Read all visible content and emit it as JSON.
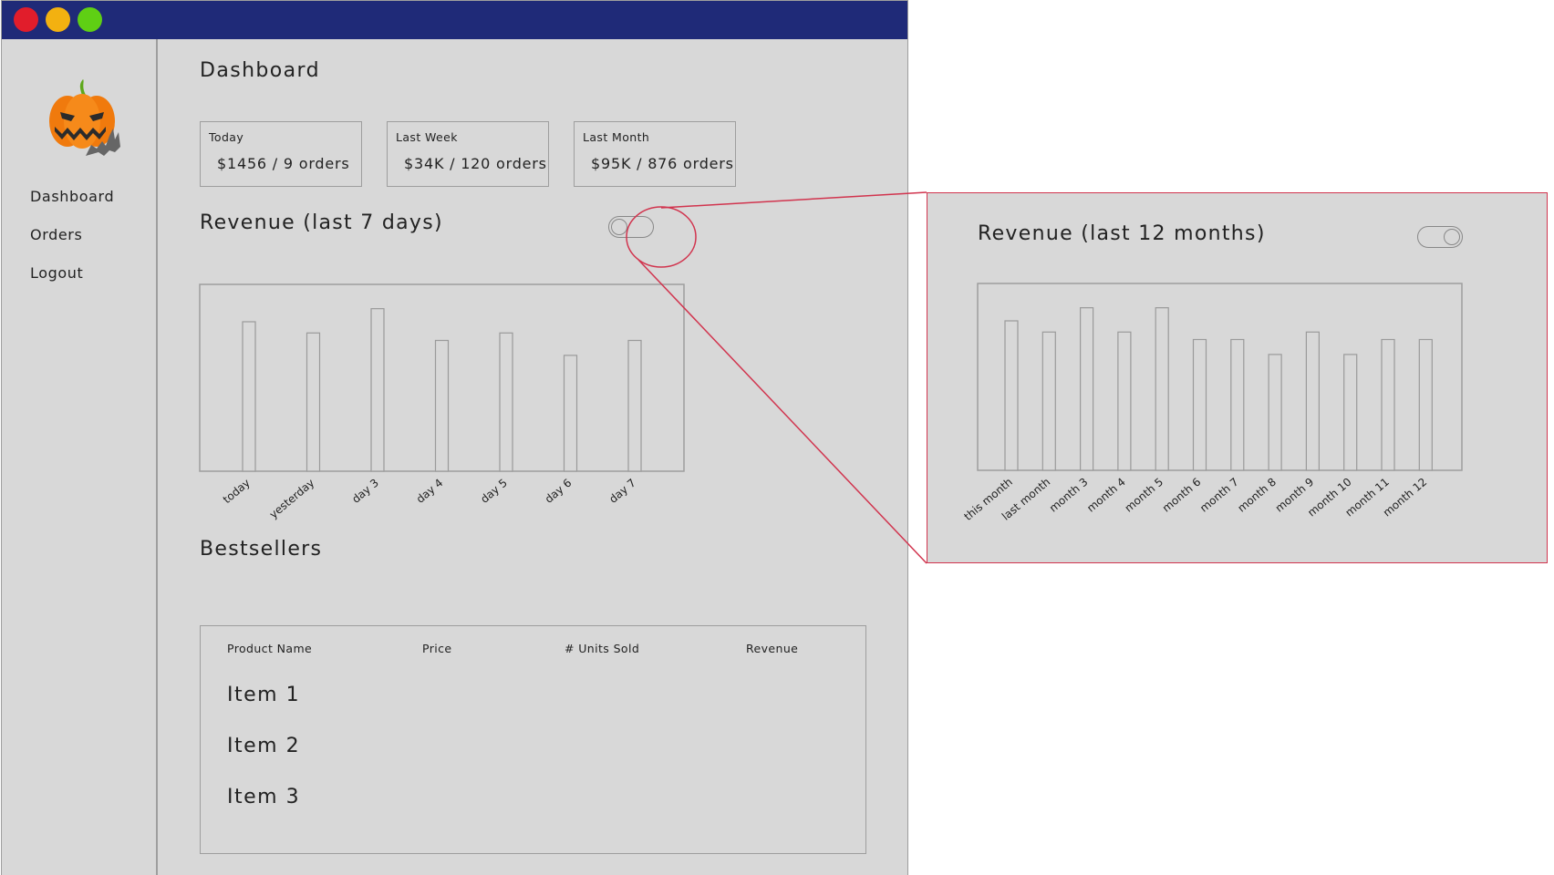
{
  "window": {
    "controls": [
      "close",
      "minimize",
      "maximize"
    ]
  },
  "sidebar": {
    "logo_icon": "jack-o-lantern-with-bat-icon",
    "items": [
      {
        "label": "Dashboard"
      },
      {
        "label": "Orders"
      },
      {
        "label": "Logout"
      }
    ]
  },
  "main": {
    "title": "Dashboard",
    "stats": [
      {
        "label": "Today",
        "value": "$1456 / 9 orders"
      },
      {
        "label": "Last Week",
        "value": "$34K / 120 orders"
      },
      {
        "label": "Last Month",
        "value": "$95K / 876 orders"
      }
    ],
    "revenue": {
      "title": "Revenue (last 7 days)",
      "toggle_on": false
    },
    "bestsellers": {
      "title": "Bestsellers",
      "columns": [
        "Product Name",
        "Price",
        "# Units Sold",
        "Revenue"
      ],
      "rows": [
        {
          "name": "Item 1"
        },
        {
          "name": "Item 2"
        },
        {
          "name": "Item 3"
        }
      ]
    }
  },
  "zoom_panel": {
    "title": "Revenue (last 12 months)",
    "toggle_on": true
  },
  "colors": {
    "titlebar": "#1f2a78",
    "close": "#e11d2b",
    "minimize": "#f3b110",
    "maximize": "#5fcf14",
    "callout": "#d1344e",
    "background": "#d8d8d8"
  },
  "chart_data": [
    {
      "type": "bar",
      "categories": [
        "today",
        "yesterday",
        "day 3",
        "day 4",
        "day 5",
        "day 6",
        "day 7"
      ],
      "values": [
        80,
        74,
        87,
        70,
        74,
        62,
        70
      ],
      "ylim": [
        0,
        100
      ],
      "grid": false
    },
    {
      "type": "bar",
      "categories": [
        "this month",
        "last month",
        "month 3",
        "month 4",
        "month 5",
        "month 6",
        "month 7",
        "month 8",
        "month 9",
        "month 10",
        "month 11",
        "month 12"
      ],
      "values": [
        80,
        74,
        87,
        74,
        87,
        70,
        70,
        62,
        74,
        62,
        70,
        70
      ],
      "ylim": [
        0,
        100
      ],
      "grid": false
    }
  ]
}
